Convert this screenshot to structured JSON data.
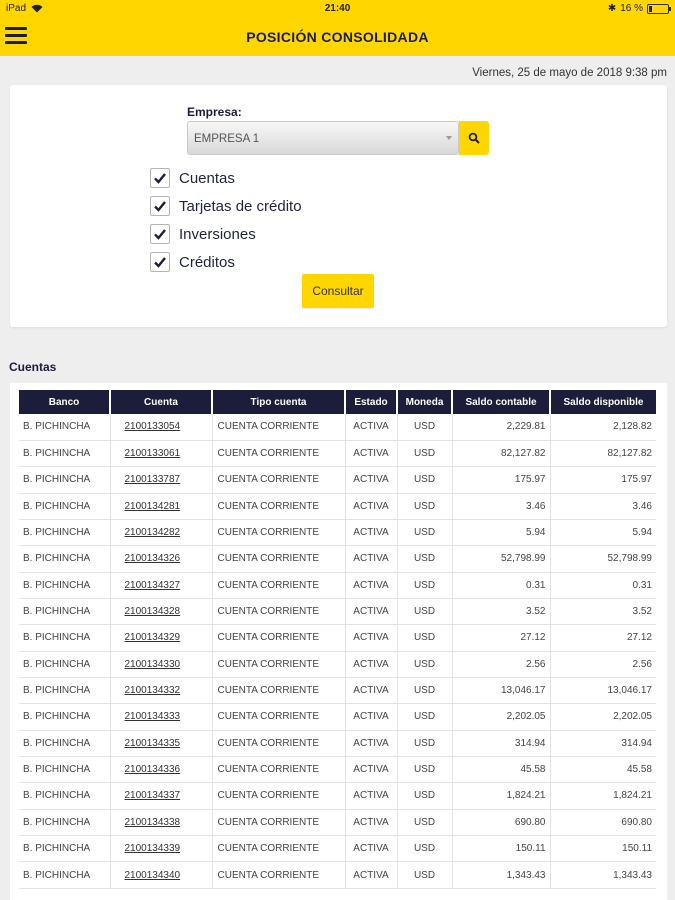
{
  "statusbar": {
    "device": "iPad",
    "time": "21:40",
    "battery": "16 %"
  },
  "header": {
    "title": "POSICIÓN CONSOLIDADA"
  },
  "datetime": "Viernes, 25 de mayo de 2018 9:38 pm",
  "form": {
    "empresa_label": "Empresa:",
    "empresa_value": "EMPRESA 1",
    "checks": [
      {
        "label": "Cuentas",
        "checked": true
      },
      {
        "label": "Tarjetas de crédito",
        "checked": true
      },
      {
        "label": "Inversiones",
        "checked": true
      },
      {
        "label": "Créditos",
        "checked": true
      }
    ],
    "consultar_label": "Consultar"
  },
  "section_title": "Cuentas",
  "table": {
    "headers": [
      "Banco",
      "Cuenta",
      "Tipo cuenta",
      "Estado",
      "Moneda",
      "Saldo contable",
      "Saldo disponible"
    ],
    "rows": [
      [
        "B. PICHINCHA",
        "2100133054",
        "CUENTA CORRIENTE",
        "ACTIVA",
        "USD",
        "2,229.81",
        "2,128.82"
      ],
      [
        "B. PICHINCHA",
        "2100133061",
        "CUENTA CORRIENTE",
        "ACTIVA",
        "USD",
        "82,127.82",
        "82,127.82"
      ],
      [
        "B. PICHINCHA",
        "2100133787",
        "CUENTA CORRIENTE",
        "ACTIVA",
        "USD",
        "175.97",
        "175.97"
      ],
      [
        "B. PICHINCHA",
        "2100134281",
        "CUENTA CORRIENTE",
        "ACTIVA",
        "USD",
        "3.46",
        "3.46"
      ],
      [
        "B. PICHINCHA",
        "2100134282",
        "CUENTA CORRIENTE",
        "ACTIVA",
        "USD",
        "5.94",
        "5.94"
      ],
      [
        "B. PICHINCHA",
        "2100134326",
        "CUENTA CORRIENTE",
        "ACTIVA",
        "USD",
        "52,798.99",
        "52,798.99"
      ],
      [
        "B. PICHINCHA",
        "2100134327",
        "CUENTA CORRIENTE",
        "ACTIVA",
        "USD",
        "0.31",
        "0.31"
      ],
      [
        "B. PICHINCHA",
        "2100134328",
        "CUENTA CORRIENTE",
        "ACTIVA",
        "USD",
        "3.52",
        "3.52"
      ],
      [
        "B. PICHINCHA",
        "2100134329",
        "CUENTA CORRIENTE",
        "ACTIVA",
        "USD",
        "27.12",
        "27.12"
      ],
      [
        "B. PICHINCHA",
        "2100134330",
        "CUENTA CORRIENTE",
        "ACTIVA",
        "USD",
        "2.56",
        "2.56"
      ],
      [
        "B. PICHINCHA",
        "2100134332",
        "CUENTA CORRIENTE",
        "ACTIVA",
        "USD",
        "13,046.17",
        "13,046.17"
      ],
      [
        "B. PICHINCHA",
        "2100134333",
        "CUENTA CORRIENTE",
        "ACTIVA",
        "USD",
        "2,202.05",
        "2,202.05"
      ],
      [
        "B. PICHINCHA",
        "2100134335",
        "CUENTA CORRIENTE",
        "ACTIVA",
        "USD",
        "314.94",
        "314.94"
      ],
      [
        "B. PICHINCHA",
        "2100134336",
        "CUENTA CORRIENTE",
        "ACTIVA",
        "USD",
        "45.58",
        "45.58"
      ],
      [
        "B. PICHINCHA",
        "2100134337",
        "CUENTA CORRIENTE",
        "ACTIVA",
        "USD",
        "1,824.21",
        "1,824.21"
      ],
      [
        "B. PICHINCHA",
        "2100134338",
        "CUENTA CORRIENTE",
        "ACTIVA",
        "USD",
        "690.80",
        "690.80"
      ],
      [
        "B. PICHINCHA",
        "2100134339",
        "CUENTA CORRIENTE",
        "ACTIVA",
        "USD",
        "150.11",
        "150.11"
      ],
      [
        "B. PICHINCHA",
        "2100134340",
        "CUENTA CORRIENTE",
        "ACTIVA",
        "USD",
        "1,343.43",
        "1,343.43"
      ]
    ]
  }
}
